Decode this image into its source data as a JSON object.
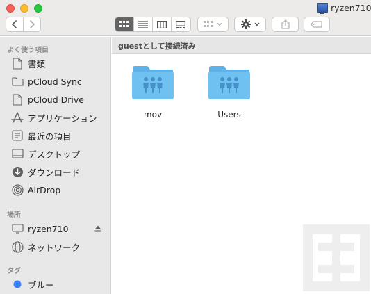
{
  "window": {
    "title": "ryzen710"
  },
  "sidebar": {
    "favorites_header": "よく使う項目",
    "favorites": [
      {
        "label": "書類",
        "icon": "document-icon"
      },
      {
        "label": "pCloud Sync",
        "icon": "folder-icon"
      },
      {
        "label": "pCloud Drive",
        "icon": "document-icon"
      },
      {
        "label": "アプリケーション",
        "icon": "applications-icon"
      },
      {
        "label": "最近の項目",
        "icon": "recents-icon"
      },
      {
        "label": "デスクトップ",
        "icon": "desktop-icon"
      },
      {
        "label": "ダウンロード",
        "icon": "download-icon"
      },
      {
        "label": "AirDrop",
        "icon": "airdrop-icon"
      }
    ],
    "locations_header": "場所",
    "locations": [
      {
        "label": "ryzen710",
        "icon": "display-icon"
      },
      {
        "label": "ネットワーク",
        "icon": "network-icon"
      }
    ],
    "tags_header": "タグ",
    "tags": [
      {
        "label": "ブルー",
        "color": "#3b82f6"
      }
    ]
  },
  "pathbar": {
    "label": "guestとして接続済み"
  },
  "files": [
    {
      "name": "mov",
      "icon": "shared-folder-icon"
    },
    {
      "name": "Users",
      "icon": "shared-folder-icon"
    }
  ],
  "colors": {
    "folder": "#69bdf0",
    "accent": "#646464"
  }
}
